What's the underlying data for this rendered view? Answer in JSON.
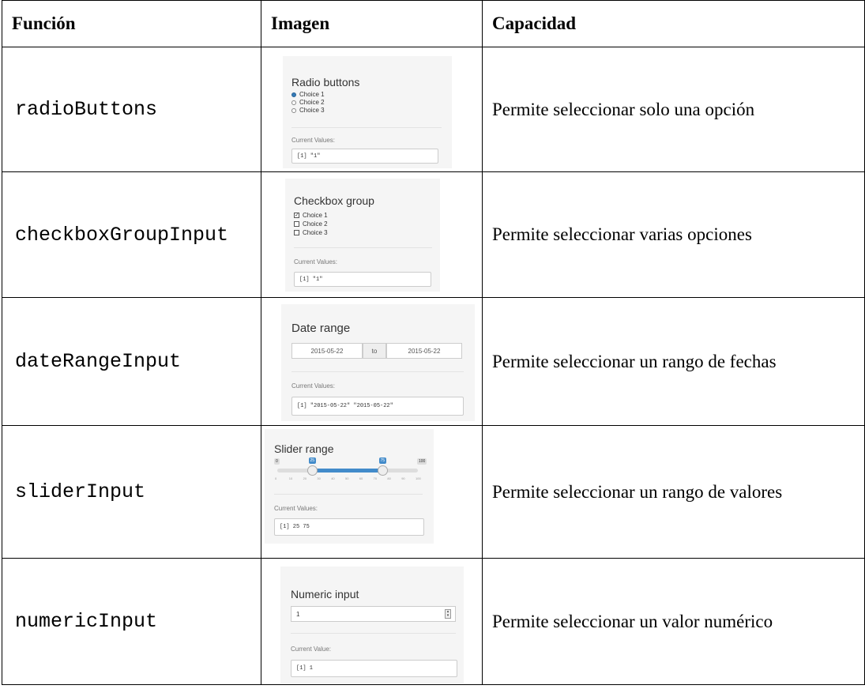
{
  "headers": {
    "funcion": "Función",
    "imagen": "Imagen",
    "capacidad": "Capacidad"
  },
  "rows": [
    {
      "function": "radioButtons",
      "capacity": "Permite seleccionar solo una opción"
    },
    {
      "function": "checkboxGroupInput",
      "capacity": "Permite seleccionar varias opciones"
    },
    {
      "function": "dateRangeInput",
      "capacity": "Permite seleccionar un rango de fechas"
    },
    {
      "function": "sliderInput",
      "capacity": "Permite seleccionar un rango de valores"
    },
    {
      "function": "numericInput",
      "capacity": "Permite seleccionar un valor numérico"
    }
  ],
  "radio_panel": {
    "title": "Radio buttons",
    "options": [
      "Choice 1",
      "Choice 2",
      "Choice 3"
    ],
    "selected": "Choice 1",
    "current_label": "Current Values:",
    "current_value": "[1] \"1\""
  },
  "checkbox_panel": {
    "title": "Checkbox group",
    "options": [
      "Choice 1",
      "Choice 2",
      "Choice 3"
    ],
    "checked": [
      "Choice 1"
    ],
    "current_label": "Current Values:",
    "current_value": "[1] \"1\""
  },
  "date_panel": {
    "title": "Date range",
    "start": "2015-05-22",
    "separator": "to",
    "end": "2015-05-22",
    "current_label": "Current Values:",
    "current_value": "[1] \"2015-05-22\" \"2015-05-22\""
  },
  "slider_panel": {
    "title": "Slider range",
    "min": "0",
    "max": "100",
    "low": "25",
    "high": "75",
    "low_value": 25,
    "high_value": 75,
    "ticks": [
      "0",
      "10",
      "20",
      "30",
      "40",
      "50",
      "60",
      "70",
      "80",
      "90",
      "100"
    ],
    "current_label": "Current Values:",
    "current_value": "[1] 25 75"
  },
  "numeric_panel": {
    "title": "Numeric input",
    "value": "1",
    "current_label": "Current Value:",
    "current_value": "[1] 1"
  }
}
